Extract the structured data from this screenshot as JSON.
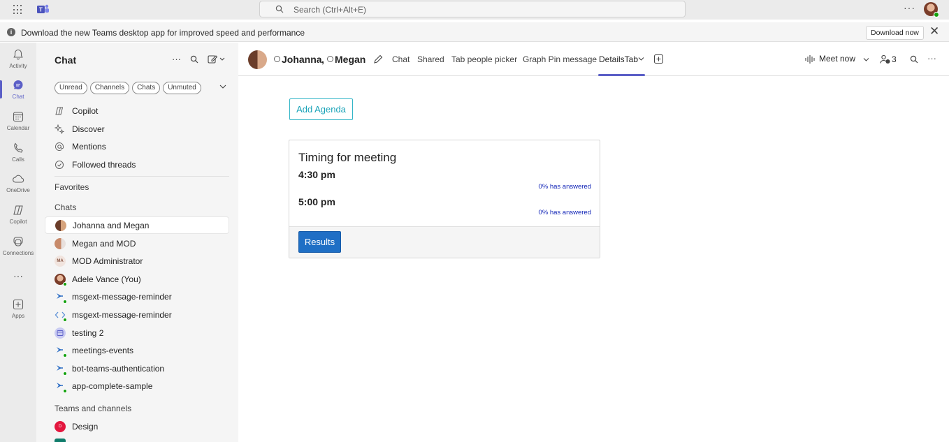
{
  "titlebar": {
    "search_placeholder": "Search (Ctrl+Alt+E)",
    "more_label": "···"
  },
  "banner": {
    "text": "Download the new Teams desktop app for improved speed and performance",
    "download_button": "Download now",
    "close_label": "✕"
  },
  "rail": {
    "items": [
      {
        "label": "Activity",
        "icon": "bell-icon"
      },
      {
        "label": "Chat",
        "icon": "chat-icon"
      },
      {
        "label": "Calendar",
        "icon": "calendar-icon"
      },
      {
        "label": "Calls",
        "icon": "phone-icon"
      },
      {
        "label": "OneDrive",
        "icon": "cloud-icon"
      },
      {
        "label": "Copilot",
        "icon": "copilot-icon"
      },
      {
        "label": "Connections",
        "icon": "connections-icon"
      },
      {
        "label": "···",
        "icon": "more-icon"
      },
      {
        "label": "Apps",
        "icon": "apps-icon"
      }
    ]
  },
  "chatpane": {
    "title": "Chat",
    "filters": [
      "Unread",
      "Channels",
      "Chats",
      "Unmuted"
    ],
    "nav": [
      {
        "label": "Copilot"
      },
      {
        "label": "Discover"
      },
      {
        "label": "Mentions"
      },
      {
        "label": "Followed threads"
      }
    ],
    "favorites_label": "Favorites",
    "chats_label": "Chats",
    "chats": [
      {
        "label": "Johanna and Megan"
      },
      {
        "label": "Megan and MOD"
      },
      {
        "label": "MOD Administrator",
        "initials": "MA"
      },
      {
        "label": "Adele Vance (You)"
      },
      {
        "label": "msgext-message-reminder"
      },
      {
        "label": "msgext-message-reminder"
      },
      {
        "label": "testing 2"
      },
      {
        "label": "meetings-events"
      },
      {
        "label": "bot-teams-authentication"
      },
      {
        "label": "app-complete-sample"
      }
    ],
    "teams_label": "Teams and channels",
    "teams": [
      {
        "label": "Design",
        "initials": "D"
      }
    ]
  },
  "header": {
    "name1": "Johanna",
    "separator": ",",
    "name2": "Megan",
    "tabs": [
      "Chat",
      "Shared",
      "Tab people picker",
      "Graph Pin message",
      "DetailsTab"
    ],
    "meet_now": "Meet now",
    "participants_count": "3"
  },
  "content": {
    "agenda_button": "Add Agenda",
    "card": {
      "title": "Timing for meeting",
      "options": [
        {
          "time": "4:30 pm",
          "answered": "0% has answered"
        },
        {
          "time": "5:00 pm",
          "answered": "0% has answered"
        }
      ],
      "results_button": "Results"
    }
  },
  "colors": {
    "accent": "#5b5fc7",
    "agenda_border": "#33b5c7",
    "results_bg": "#1f6fc5",
    "answered_text": "#0b1fb5",
    "presence": "#13a10e"
  }
}
